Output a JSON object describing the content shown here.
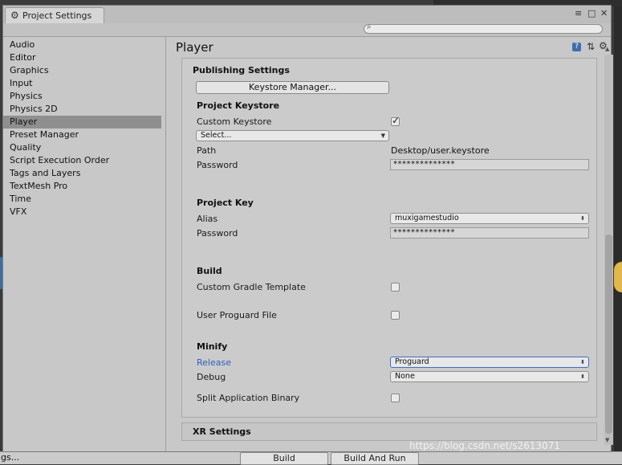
{
  "window": {
    "tab_title": "Project Settings",
    "tab_icon": "gear-icon",
    "controls": [
      "≡",
      "□",
      "✕"
    ]
  },
  "search": {
    "placeholder": "",
    "icon": "search-icon"
  },
  "sidebar": {
    "items": [
      {
        "label": "Audio"
      },
      {
        "label": "Editor"
      },
      {
        "label": "Graphics"
      },
      {
        "label": "Input"
      },
      {
        "label": "Physics"
      },
      {
        "label": "Physics 2D"
      },
      {
        "label": "Player",
        "selected": true
      },
      {
        "label": "Preset Manager"
      },
      {
        "label": "Quality"
      },
      {
        "label": "Script Execution Order"
      },
      {
        "label": "Tags and Layers"
      },
      {
        "label": "TextMesh Pro"
      },
      {
        "label": "Time"
      },
      {
        "label": "VFX"
      }
    ]
  },
  "player": {
    "title": "Player",
    "publishing": {
      "title": "Publishing Settings",
      "keystore_manager_label": "Keystore Manager..."
    },
    "project_keystore": {
      "title": "Project Keystore",
      "custom_keystore_label": "Custom Keystore",
      "custom_keystore_checked": true,
      "select_value": "Select...",
      "path_label": "Path",
      "path_value": "Desktop/user.keystore",
      "password_label": "Password",
      "password_value": "**************"
    },
    "project_key": {
      "title": "Project Key",
      "alias_label": "Alias",
      "alias_value": "muxigamestudio",
      "password_label": "Password",
      "password_value": "**************"
    },
    "build": {
      "title": "Build",
      "custom_gradle_label": "Custom Gradle Template",
      "custom_gradle_checked": false,
      "user_proguard_label": "User Proguard File",
      "user_proguard_checked": false
    },
    "minify": {
      "title": "Minify",
      "release_label": "Release",
      "release_value": "Proguard",
      "debug_label": "Debug",
      "debug_value": "None"
    },
    "split_binary_label": "Split Application Binary",
    "split_binary_checked": false,
    "xr_settings_title": "XR Settings"
  },
  "background": {
    "bottom_left_text": "gs...",
    "build_label": "Build",
    "build_and_run_label": "Build And Run"
  },
  "watermark": "https://blog.csdn.net/s2613071"
}
